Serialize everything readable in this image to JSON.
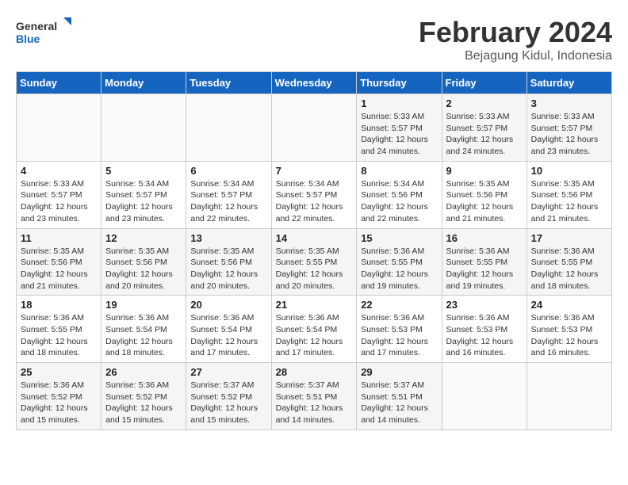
{
  "logo": {
    "text_general": "General",
    "text_blue": "Blue"
  },
  "header": {
    "title": "February 2024",
    "location": "Bejagung Kidul, Indonesia"
  },
  "days_of_week": [
    "Sunday",
    "Monday",
    "Tuesday",
    "Wednesday",
    "Thursday",
    "Friday",
    "Saturday"
  ],
  "weeks": [
    [
      {
        "day": "",
        "info": ""
      },
      {
        "day": "",
        "info": ""
      },
      {
        "day": "",
        "info": ""
      },
      {
        "day": "",
        "info": ""
      },
      {
        "day": "1",
        "info": "Sunrise: 5:33 AM\nSunset: 5:57 PM\nDaylight: 12 hours\nand 24 minutes."
      },
      {
        "day": "2",
        "info": "Sunrise: 5:33 AM\nSunset: 5:57 PM\nDaylight: 12 hours\nand 24 minutes."
      },
      {
        "day": "3",
        "info": "Sunrise: 5:33 AM\nSunset: 5:57 PM\nDaylight: 12 hours\nand 23 minutes."
      }
    ],
    [
      {
        "day": "4",
        "info": "Sunrise: 5:33 AM\nSunset: 5:57 PM\nDaylight: 12 hours\nand 23 minutes."
      },
      {
        "day": "5",
        "info": "Sunrise: 5:34 AM\nSunset: 5:57 PM\nDaylight: 12 hours\nand 23 minutes."
      },
      {
        "day": "6",
        "info": "Sunrise: 5:34 AM\nSunset: 5:57 PM\nDaylight: 12 hours\nand 22 minutes."
      },
      {
        "day": "7",
        "info": "Sunrise: 5:34 AM\nSunset: 5:57 PM\nDaylight: 12 hours\nand 22 minutes."
      },
      {
        "day": "8",
        "info": "Sunrise: 5:34 AM\nSunset: 5:56 PM\nDaylight: 12 hours\nand 22 minutes."
      },
      {
        "day": "9",
        "info": "Sunrise: 5:35 AM\nSunset: 5:56 PM\nDaylight: 12 hours\nand 21 minutes."
      },
      {
        "day": "10",
        "info": "Sunrise: 5:35 AM\nSunset: 5:56 PM\nDaylight: 12 hours\nand 21 minutes."
      }
    ],
    [
      {
        "day": "11",
        "info": "Sunrise: 5:35 AM\nSunset: 5:56 PM\nDaylight: 12 hours\nand 21 minutes."
      },
      {
        "day": "12",
        "info": "Sunrise: 5:35 AM\nSunset: 5:56 PM\nDaylight: 12 hours\nand 20 minutes."
      },
      {
        "day": "13",
        "info": "Sunrise: 5:35 AM\nSunset: 5:56 PM\nDaylight: 12 hours\nand 20 minutes."
      },
      {
        "day": "14",
        "info": "Sunrise: 5:35 AM\nSunset: 5:55 PM\nDaylight: 12 hours\nand 20 minutes."
      },
      {
        "day": "15",
        "info": "Sunrise: 5:36 AM\nSunset: 5:55 PM\nDaylight: 12 hours\nand 19 minutes."
      },
      {
        "day": "16",
        "info": "Sunrise: 5:36 AM\nSunset: 5:55 PM\nDaylight: 12 hours\nand 19 minutes."
      },
      {
        "day": "17",
        "info": "Sunrise: 5:36 AM\nSunset: 5:55 PM\nDaylight: 12 hours\nand 18 minutes."
      }
    ],
    [
      {
        "day": "18",
        "info": "Sunrise: 5:36 AM\nSunset: 5:55 PM\nDaylight: 12 hours\nand 18 minutes."
      },
      {
        "day": "19",
        "info": "Sunrise: 5:36 AM\nSunset: 5:54 PM\nDaylight: 12 hours\nand 18 minutes."
      },
      {
        "day": "20",
        "info": "Sunrise: 5:36 AM\nSunset: 5:54 PM\nDaylight: 12 hours\nand 17 minutes."
      },
      {
        "day": "21",
        "info": "Sunrise: 5:36 AM\nSunset: 5:54 PM\nDaylight: 12 hours\nand 17 minutes."
      },
      {
        "day": "22",
        "info": "Sunrise: 5:36 AM\nSunset: 5:53 PM\nDaylight: 12 hours\nand 17 minutes."
      },
      {
        "day": "23",
        "info": "Sunrise: 5:36 AM\nSunset: 5:53 PM\nDaylight: 12 hours\nand 16 minutes."
      },
      {
        "day": "24",
        "info": "Sunrise: 5:36 AM\nSunset: 5:53 PM\nDaylight: 12 hours\nand 16 minutes."
      }
    ],
    [
      {
        "day": "25",
        "info": "Sunrise: 5:36 AM\nSunset: 5:52 PM\nDaylight: 12 hours\nand 15 minutes."
      },
      {
        "day": "26",
        "info": "Sunrise: 5:36 AM\nSunset: 5:52 PM\nDaylight: 12 hours\nand 15 minutes."
      },
      {
        "day": "27",
        "info": "Sunrise: 5:37 AM\nSunset: 5:52 PM\nDaylight: 12 hours\nand 15 minutes."
      },
      {
        "day": "28",
        "info": "Sunrise: 5:37 AM\nSunset: 5:51 PM\nDaylight: 12 hours\nand 14 minutes."
      },
      {
        "day": "29",
        "info": "Sunrise: 5:37 AM\nSunset: 5:51 PM\nDaylight: 12 hours\nand 14 minutes."
      },
      {
        "day": "",
        "info": ""
      },
      {
        "day": "",
        "info": ""
      }
    ]
  ]
}
